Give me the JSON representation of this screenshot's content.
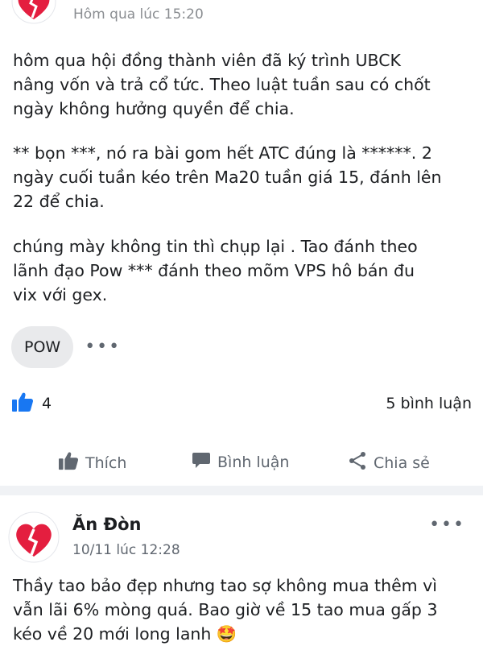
{
  "post1": {
    "timestamp": "Hôm qua lúc 15:20",
    "paragraphs": [
      [
        "hôm qua hội đồng thành viên đã ký trình UBCK",
        "nâng vốn và trả cổ tức. Theo luật tuần sau có chốt",
        "ngày không hưởng quyền để chia."
      ],
      [
        "** bọn ***, nó ra bài gom hết ATC đúng là ******. 2",
        "ngày cuối tuần kéo trên Ma20 tuần giá 15, đánh lên",
        "22 để chia."
      ],
      [
        "chúng mày không tin thì chụp lại . Tao đánh theo",
        "lãnh đạo Pow *** đánh theo mõm VPS hô bán đu",
        "vix với gex."
      ]
    ],
    "tag": "POW",
    "more": "•••",
    "like_count": "4",
    "comment_count": "5 bình luận",
    "actions": {
      "like": "Thích",
      "comment": "Bình luận",
      "share": "Chia sẻ"
    }
  },
  "post2": {
    "author": "Ăn Đòn",
    "timestamp": "10/11 lúc 12:28",
    "more": "•••",
    "lines": [
      "Thầy tao bảo đẹp nhưng tao sợ không mua thêm vì",
      "vẫn lãi 6% mòng quá. Bao giờ về 15 tao mua gấp 3",
      "kéo về 20 mới long lanh 🤩"
    ]
  },
  "colors": {
    "accent": "#1877f2",
    "heart": "#e41e3f",
    "muted": "#606770",
    "divider": "#f0f2f5"
  },
  "icons": [
    "broken-heart-avatar-icon",
    "thumbs-up-icon",
    "comment-icon",
    "share-icon"
  ]
}
